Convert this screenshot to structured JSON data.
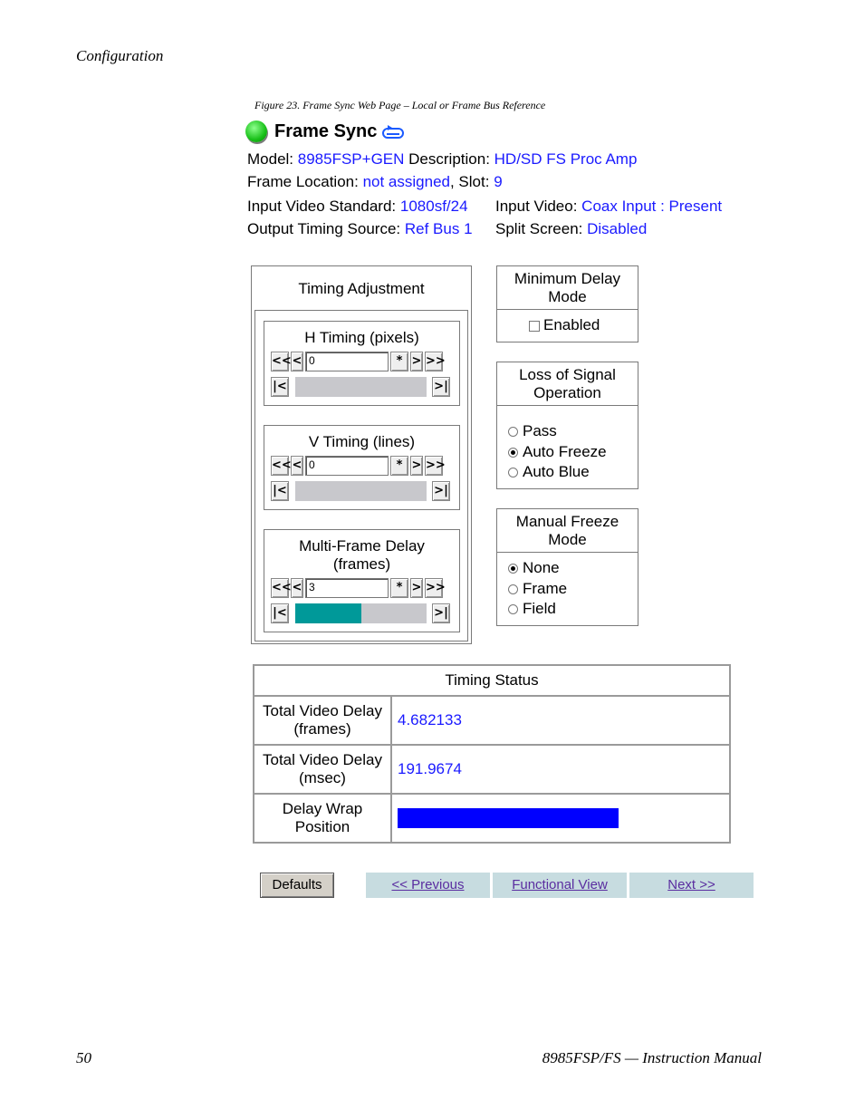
{
  "doc": {
    "section": "Configuration",
    "figure_caption": "Figure 23.  Frame Sync Web Page – Local or Frame Bus Reference",
    "page_number": "50",
    "manual_title": "8985FSP/FS — Instruction Manual"
  },
  "page": {
    "title": "Frame Sync",
    "model_label": "Model:",
    "model_value": "8985FSP+GEN",
    "description_label": "Description:",
    "description_value": "HD/SD FS Proc Amp",
    "frame_location_label": "Frame Location:",
    "frame_location_value": "not assigned",
    "slot_label": ", Slot:",
    "slot_value": "9",
    "input_std_label": "Input Video Standard:",
    "input_std_value": "1080sf/24",
    "input_video_label": "Input Video:",
    "input_video_value": "Coax Input : Present",
    "output_timing_label": "Output Timing Source:",
    "output_timing_value": "Ref Bus 1",
    "split_screen_label": "Split Screen:",
    "split_screen_value": "Disabled"
  },
  "timing_adjustment": {
    "title": "Timing Adjustment",
    "h_timing": {
      "title": "H Timing (pixels)",
      "value": "0",
      "level": 0
    },
    "v_timing": {
      "title": "V Timing (lines)",
      "value": "0",
      "level": 0
    },
    "multi_frame": {
      "title_line1": "Multi-Frame Delay",
      "title_line2": "(frames)",
      "value": "3",
      "level": 0.5
    },
    "btn_fast_back": "<<",
    "btn_back": "<",
    "btn_default": "*",
    "btn_fwd": ">",
    "btn_fast_fwd": ">>",
    "btn_min": "|<",
    "btn_max": ">|"
  },
  "min_delay": {
    "title_line1": "Minimum Delay",
    "title_line2": "Mode",
    "enabled_label": "Enabled",
    "enabled": false
  },
  "loss_signal": {
    "title_line1": "Loss of Signal",
    "title_line2": "Operation",
    "options": [
      "Pass",
      "Auto Freeze",
      "Auto Blue"
    ],
    "selected": "Auto Freeze"
  },
  "manual_freeze": {
    "title_line1": "Manual Freeze",
    "title_line2": "Mode",
    "options": [
      "None",
      "Frame",
      "Field"
    ],
    "selected": "None"
  },
  "timing_status": {
    "title": "Timing Status",
    "rows": [
      {
        "label_line1": "Total Video Delay",
        "label_line2": "(frames)",
        "value": "4.682133"
      },
      {
        "label_line1": "Total Video Delay",
        "label_line2": "(msec)",
        "value": "191.9674"
      },
      {
        "label_line1": "Delay Wrap",
        "label_line2": "Position"
      }
    ]
  },
  "buttons": {
    "defaults": "Defaults",
    "previous": "<< Previous",
    "functional_view": "Functional View",
    "next": "Next >>"
  }
}
